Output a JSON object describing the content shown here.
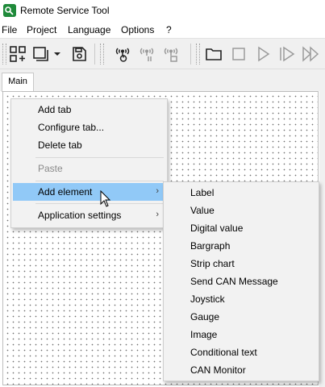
{
  "window": {
    "title": "Remote Service Tool",
    "icon": "app-icon"
  },
  "menubar": {
    "items": [
      {
        "label": "File"
      },
      {
        "label": "Project"
      },
      {
        "label": "Language"
      },
      {
        "label": "Options"
      },
      {
        "label": "?"
      }
    ]
  },
  "toolbar": {
    "buttons": [
      {
        "icon": "add-grid-icon"
      },
      {
        "icon": "window-dropdown-icon"
      },
      {
        "icon": "save-icon"
      },
      {
        "icon": "connect-icon"
      },
      {
        "icon": "pause-connection-icon"
      },
      {
        "icon": "stop-connection-icon"
      },
      {
        "icon": "folder-icon"
      },
      {
        "icon": "stop-icon"
      },
      {
        "icon": "play-icon"
      },
      {
        "icon": "step-icon"
      },
      {
        "icon": "fast-forward-icon"
      }
    ]
  },
  "tabs": [
    {
      "label": "Main",
      "active": true
    }
  ],
  "context_menu": {
    "items": [
      {
        "label": "Add tab"
      },
      {
        "label": "Configure tab..."
      },
      {
        "label": "Delete tab"
      },
      {
        "label": "Paste",
        "disabled": true
      },
      {
        "label": "Add element",
        "highlighted": true,
        "has_submenu": true
      },
      {
        "label": "Application settings",
        "has_submenu": true
      }
    ],
    "highlight_color": "#91c9f7"
  },
  "submenu": {
    "items": [
      {
        "label": "Label"
      },
      {
        "label": "Value"
      },
      {
        "label": "Digital value"
      },
      {
        "label": "Bargraph"
      },
      {
        "label": "Strip chart"
      },
      {
        "label": "Send CAN Message"
      },
      {
        "label": "Joystick"
      },
      {
        "label": "Gauge"
      },
      {
        "label": "Image"
      },
      {
        "label": "Conditional text"
      },
      {
        "label": "CAN Monitor"
      }
    ]
  }
}
